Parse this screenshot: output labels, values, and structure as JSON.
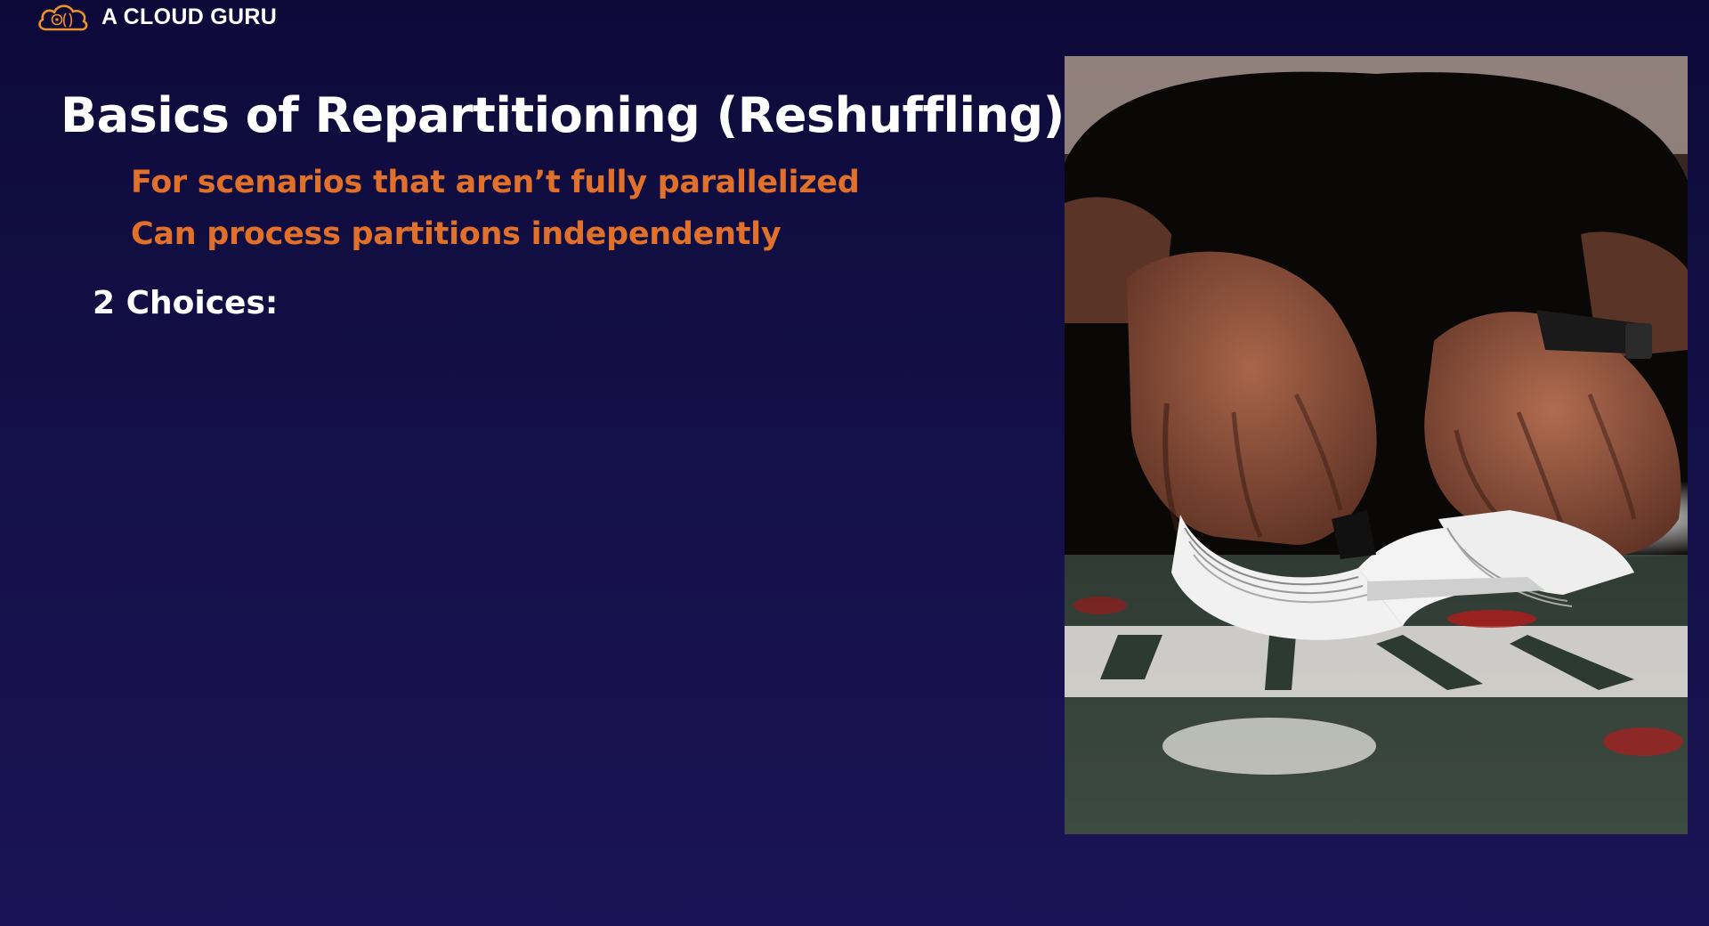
{
  "brand": {
    "name": "A CLOUD GURU",
    "accent": "#f0922c"
  },
  "slide": {
    "title": "Basics of Repartitioning (Reshuffling)",
    "bullets": [
      "For scenarios that aren’t fully parallelized",
      "Can process partitions independently"
    ],
    "choices_label": "2 Choices:"
  },
  "colors": {
    "background": "#141047",
    "title": "#ffffff",
    "bullet": "#e0702a"
  },
  "image": {
    "icon": "card-shuffle-photo"
  }
}
